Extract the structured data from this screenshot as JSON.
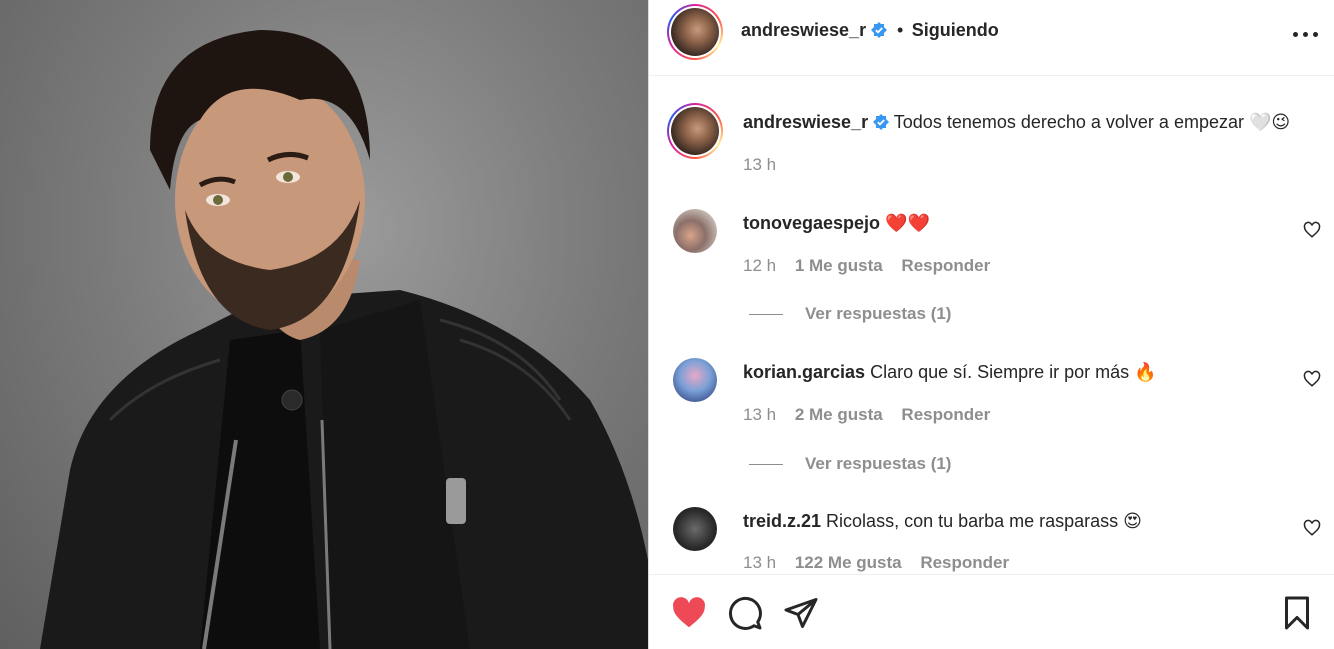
{
  "post": {
    "author": "andreswiese_r",
    "follow_separator": "•",
    "follow_status": "Siguiendo",
    "caption": "Todos tenemos derecho a volver a empezar 🤍😉",
    "caption_time": "13 h"
  },
  "comments": [
    {
      "username": "tonovegaespejo",
      "text": "❤️❤️",
      "time": "12 h",
      "likes": "1 Me gusta",
      "reply_label": "Responder",
      "view_replies": "Ver respuestas (1)"
    },
    {
      "username": "korian.garcias",
      "text": "Claro que sí. Siempre ir por más 🔥",
      "time": "13 h",
      "likes": "2 Me gusta",
      "reply_label": "Responder",
      "view_replies": "Ver respuestas (1)"
    },
    {
      "username": "treid.z.21",
      "text": "Ricolass, con tu barba me rasparass 😍",
      "time": "13 h",
      "likes": "122 Me gusta",
      "reply_label": "Responder"
    }
  ],
  "actions": {
    "liked": true,
    "like_color": "#ed4956"
  },
  "colors": {
    "verified": "#3897f0",
    "muted": "#8e8e8e",
    "text": "#262626"
  },
  "icons": {
    "more": "more-horizontal-icon",
    "like": "heart-icon",
    "comment": "comment-icon",
    "share": "send-icon",
    "save": "bookmark-icon",
    "verified": "verified-badge-icon"
  }
}
